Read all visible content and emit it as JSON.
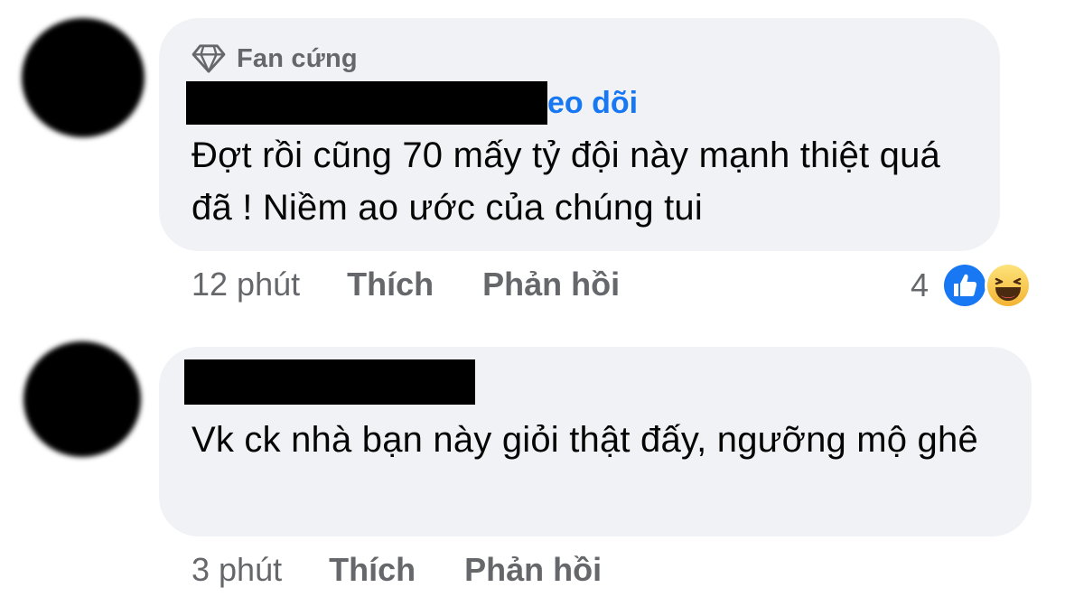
{
  "comments": [
    {
      "badge": "Fan cứng",
      "name_suffix": "eo dõi",
      "text": "Đợt rồi cũng 70 mấy tỷ đội này mạnh thiệt quá đã ! Niềm ao ước của chúng tui",
      "time": "12 phút",
      "like_label": "Thích",
      "reply_label": "Phản hồi",
      "reaction_count": "4",
      "reactions": [
        "like-icon",
        "haha-icon"
      ]
    },
    {
      "text": "Vk ck nhà bạn này giỏi thật đấy, ngưỡng mộ ghê",
      "time": "3 phút",
      "like_label": "Thích",
      "reply_label": "Phản hồi"
    }
  ],
  "colors": {
    "bubble": "#f0f2f5",
    "meta_text": "#65676b",
    "link_blue": "#1877f2",
    "like_blue": "#1877f2",
    "haha_yellow": "#f7c94b"
  }
}
